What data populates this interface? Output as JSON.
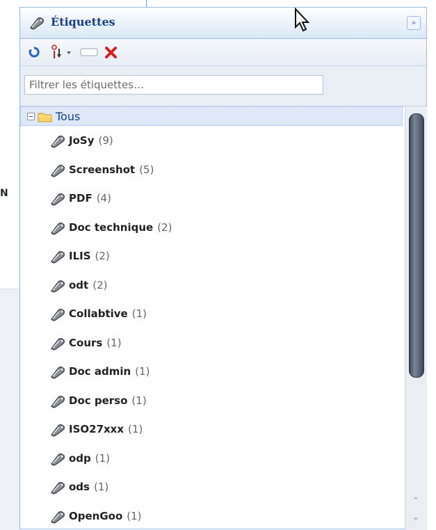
{
  "panel": {
    "title": "Étiquettes",
    "filter_placeholder": "Filtrer les étiquettes…",
    "root_label": "Tous",
    "stray_letter": "N"
  },
  "tags": [
    {
      "name": "JoSy",
      "count": "(9)"
    },
    {
      "name": "Screenshot",
      "count": "(5)"
    },
    {
      "name": "PDF",
      "count": "(4)"
    },
    {
      "name": "Doc technique",
      "count": "(2)"
    },
    {
      "name": "ILIS",
      "count": "(2)"
    },
    {
      "name": "odt",
      "count": "(2)"
    },
    {
      "name": "Collabtive",
      "count": "(1)"
    },
    {
      "name": "Cours",
      "count": "(1)"
    },
    {
      "name": "Doc admin",
      "count": "(1)"
    },
    {
      "name": "Doc perso",
      "count": "(1)"
    },
    {
      "name": "ISO27xxx",
      "count": "(1)"
    },
    {
      "name": "odp",
      "count": "(1)"
    },
    {
      "name": "ods",
      "count": "(1)"
    },
    {
      "name": "OpenGoo",
      "count": "(1)"
    }
  ],
  "icons": {
    "header": "tag-icon",
    "collapse": "double-chevron-icon",
    "refresh": "refresh-icon",
    "sort": "sort-icon",
    "rename": "rename-icon",
    "delete": "delete-icon",
    "folder": "folder-icon"
  },
  "colors": {
    "title": "#15428b",
    "border": "#99bbe8",
    "selected_row": "#dfe8f6"
  }
}
